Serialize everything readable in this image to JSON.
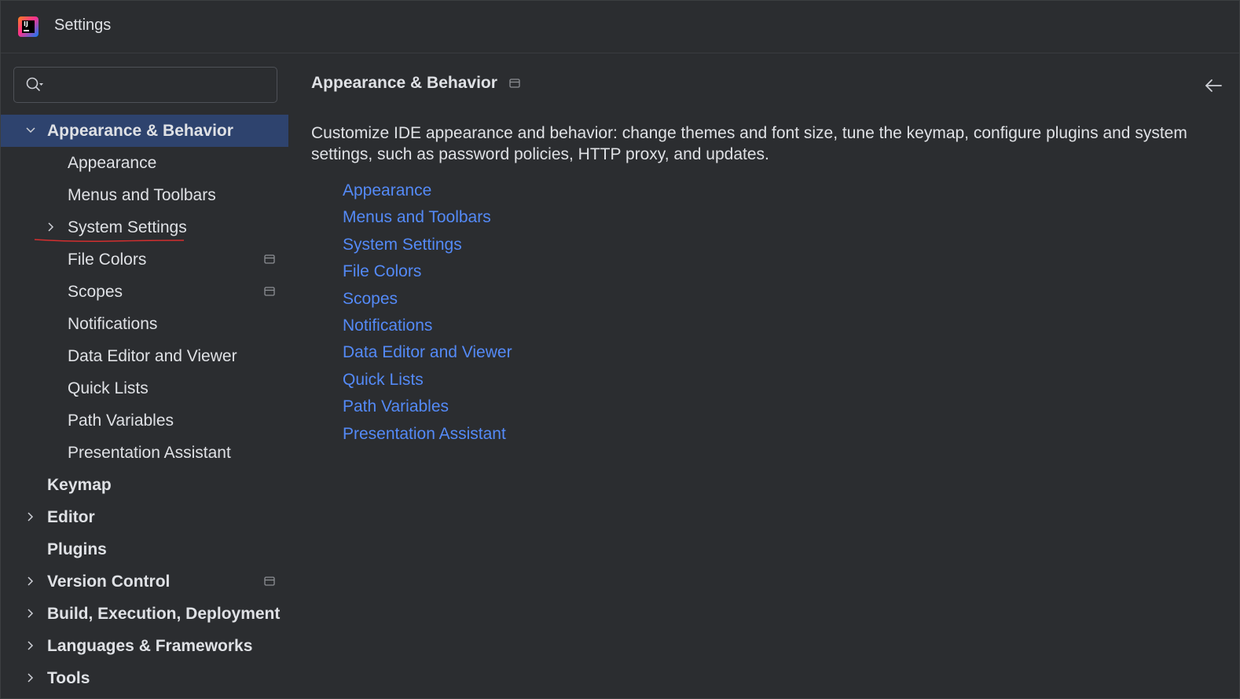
{
  "window": {
    "title": "Settings"
  },
  "search": {
    "value": "",
    "placeholder": ""
  },
  "sidebar": {
    "items": [
      {
        "label": "Appearance & Behavior",
        "level": 0,
        "bold": true,
        "expanded": true,
        "selected": true,
        "chevron": "chevron-down-icon"
      },
      {
        "label": "Appearance",
        "level": 1
      },
      {
        "label": "Menus and Toolbars",
        "level": 1
      },
      {
        "label": "System Settings",
        "level": 1,
        "chevron": "chevron-right-icon",
        "annotated": true
      },
      {
        "label": "File Colors",
        "level": 1,
        "project_icon": true
      },
      {
        "label": "Scopes",
        "level": 1,
        "project_icon": true
      },
      {
        "label": "Notifications",
        "level": 1
      },
      {
        "label": "Data Editor and Viewer",
        "level": 1
      },
      {
        "label": "Quick Lists",
        "level": 1
      },
      {
        "label": "Path Variables",
        "level": 1
      },
      {
        "label": "Presentation Assistant",
        "level": 1
      },
      {
        "label": "Keymap",
        "level": 0,
        "bold": true
      },
      {
        "label": "Editor",
        "level": 0,
        "bold": true,
        "chevron": "chevron-right-icon"
      },
      {
        "label": "Plugins",
        "level": 0,
        "bold": true
      },
      {
        "label": "Version Control",
        "level": 0,
        "bold": true,
        "chevron": "chevron-right-icon",
        "project_icon": true
      },
      {
        "label": "Build, Execution, Deployment",
        "level": 0,
        "bold": true,
        "chevron": "chevron-right-icon"
      },
      {
        "label": "Languages & Frameworks",
        "level": 0,
        "bold": true,
        "chevron": "chevron-right-icon"
      },
      {
        "label": "Tools",
        "level": 0,
        "bold": true,
        "chevron": "chevron-right-icon"
      }
    ]
  },
  "main": {
    "title": "Appearance & Behavior",
    "description": "Customize IDE appearance and behavior: change themes and font size, tune the keymap, configure plugins and system settings, such as password policies, HTTP proxy, and updates.",
    "links": [
      "Appearance",
      "Menus and Toolbars",
      "System Settings",
      "File Colors",
      "Scopes",
      "Notifications",
      "Data Editor and Viewer",
      "Quick Lists",
      "Path Variables",
      "Presentation Assistant"
    ]
  },
  "colors": {
    "background": "#2b2d30",
    "selection": "#2e436e",
    "link": "#548af7",
    "text": "#dfe1e5",
    "annotation": "#d32f2f"
  }
}
